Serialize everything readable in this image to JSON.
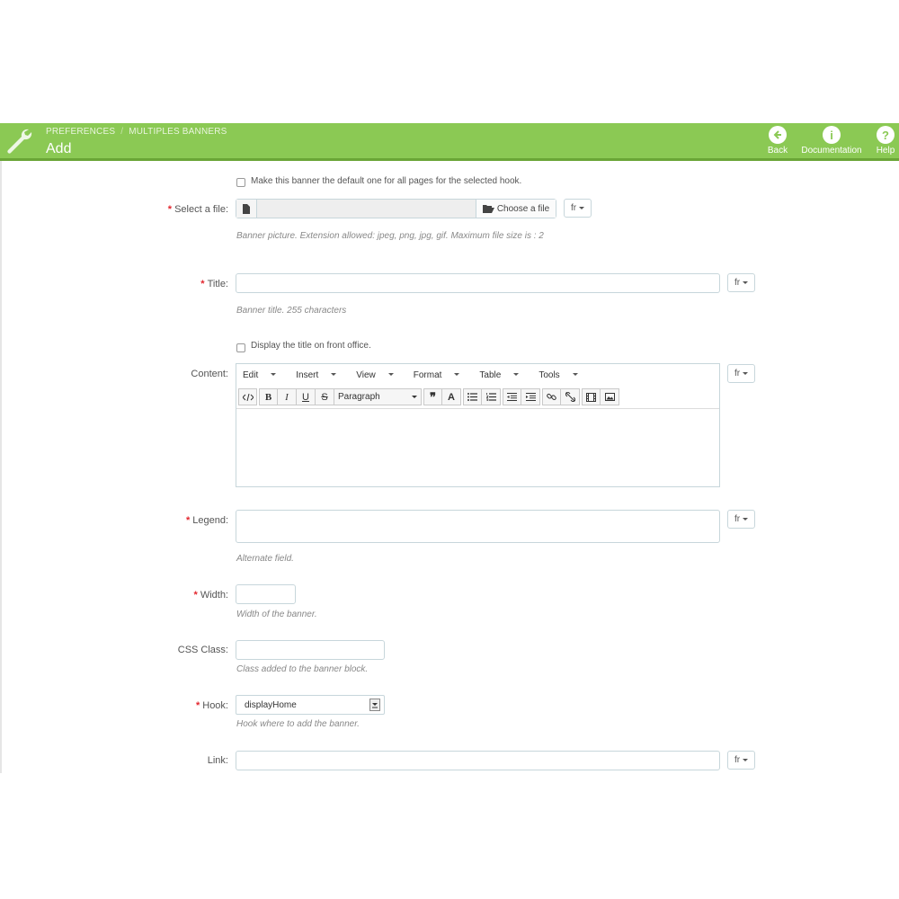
{
  "header": {
    "breadcrumb": [
      "PREFERENCES",
      "MULTIPLES BANNERS"
    ],
    "breadcrumb_sep": "/",
    "title": "Add",
    "buttons": [
      {
        "label": "Back",
        "icon": "back-arrow-icon"
      },
      {
        "label": "Documentation",
        "icon": "info-icon"
      },
      {
        "label": "Help",
        "icon": "help-icon"
      }
    ],
    "brand_color": "#8bc954"
  },
  "form": {
    "default_checkbox": {
      "label": "Make this banner the default one for all pages for the selected hook.",
      "checked": false
    },
    "file": {
      "required": "*",
      "label": "Select a file:",
      "button": "Choose a file",
      "lang": "fr",
      "help": "Banner picture. Extension allowed: jpeg, png, jpg, gif. Maximum file size is : 2"
    },
    "title": {
      "required": "*",
      "label": "Title:",
      "value": "",
      "lang": "fr",
      "help": "Banner title. 255 characters"
    },
    "display_title_checkbox": {
      "label": "Display the title on front office.",
      "checked": false
    },
    "content": {
      "label": "Content:",
      "lang": "fr",
      "menus": [
        "Edit",
        "Insert",
        "View",
        "Format",
        "Table",
        "Tools"
      ],
      "block_format": "Paragraph"
    },
    "legend": {
      "required": "*",
      "label": "Legend:",
      "value": "",
      "lang": "fr",
      "help": "Alternate field."
    },
    "width": {
      "required": "*",
      "label": "Width:",
      "value": "",
      "help": "Width of the banner."
    },
    "css_class": {
      "label": "CSS Class:",
      "value": "",
      "help": "Class added to the banner block."
    },
    "hook": {
      "required": "*",
      "label": "Hook:",
      "value": "displayHome",
      "help": "Hook where to add the banner."
    },
    "link": {
      "label": "Link:",
      "value": "",
      "lang": "fr"
    }
  },
  "required_color": "#e3262e"
}
